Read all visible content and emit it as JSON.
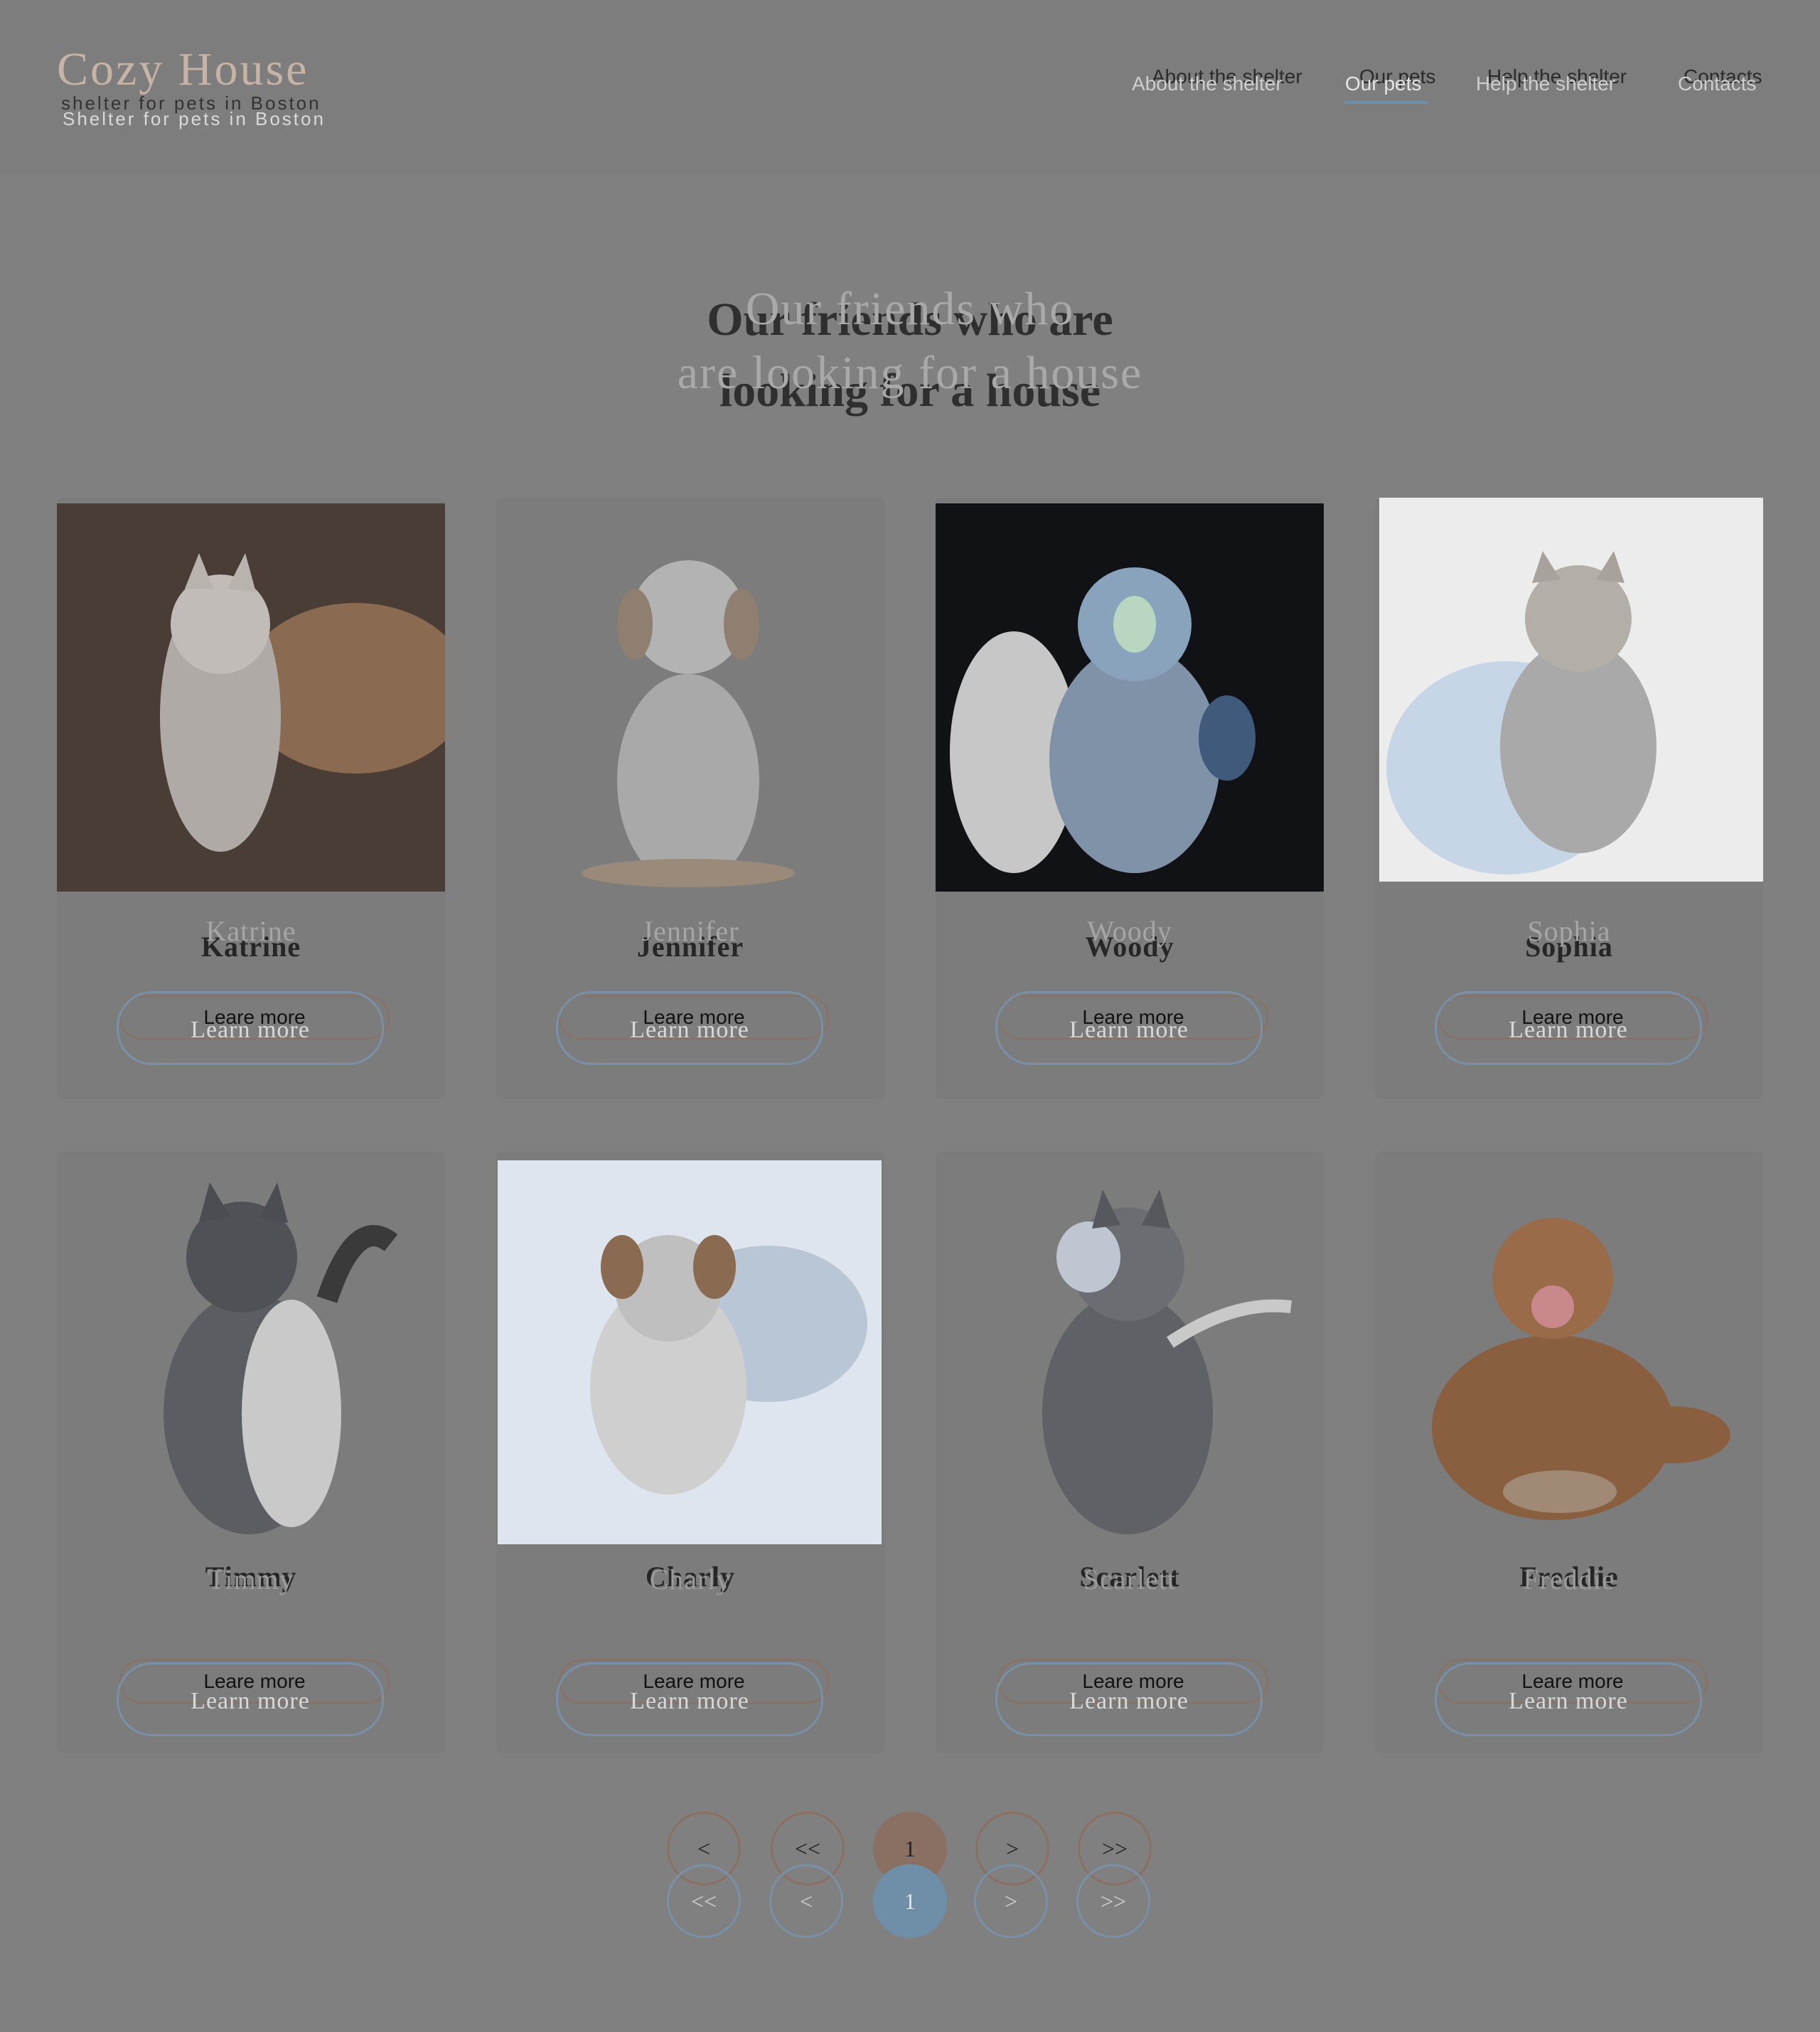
{
  "toolbar": {
    "add": "+",
    "items": [
      "add-icon",
      "eye-icon",
      "lock-icon",
      "contrast-icon"
    ]
  },
  "logo": {
    "title": "Cozy House",
    "tagline_back": "shelter for pets in Boston",
    "tagline_front": "Shelter for pets in Boston"
  },
  "nav": {
    "back": [
      "About the shelter",
      "Our pets",
      "Help the shelter",
      "Contacts"
    ],
    "front": [
      "About the shelter",
      "Our pets",
      "Help the shelter",
      "Contacts"
    ],
    "active": "Our pets"
  },
  "heading": {
    "back_line1": "Our friends who are",
    "back_line2": "looking for a house",
    "front_line1": "Our friends who",
    "front_line2": "are looking for a house"
  },
  "pets_back": [
    "Katrine",
    "Jennifer",
    "Woody",
    "Sophia",
    "Timmy",
    "Charly",
    "Scarlett",
    "Freddie"
  ],
  "pets_front": [
    "Katrine",
    "Jennifer",
    "Woody",
    "Sophia",
    "Timmy",
    "Charly",
    "Scarlett",
    "Freddie"
  ],
  "button_back_label": "Leare more",
  "button_front_label": "Learn more",
  "pagination": {
    "back": [
      "<",
      "<<",
      "1",
      ">",
      ">>"
    ],
    "front": [
      "<<",
      "<",
      "1",
      ">",
      ">>"
    ],
    "current": "1"
  },
  "colors": {
    "accent": "#6f8fa8",
    "accent_back": "#8a7062"
  }
}
